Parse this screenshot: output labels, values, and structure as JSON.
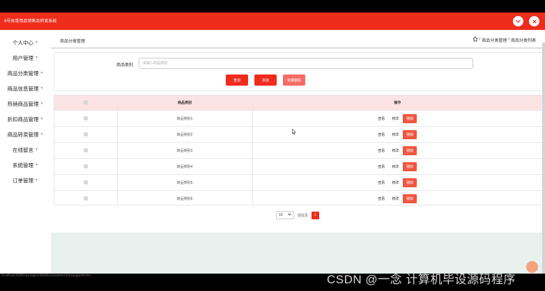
{
  "app": {
    "title": "8号体育用品销售及转卖系统"
  },
  "sidebar": {
    "items": [
      {
        "label": "个人中心"
      },
      {
        "label": "用户管理"
      },
      {
        "label": "商品分类管理"
      },
      {
        "label": "商品信息管理"
      },
      {
        "label": "热销商品管理"
      },
      {
        "label": "折扣商品管理"
      },
      {
        "label": "商品转卖管理"
      },
      {
        "label": "在线留言"
      },
      {
        "label": "系统管理"
      },
      {
        "label": "订单管理"
      }
    ]
  },
  "breadcrumb": {
    "page_title": "商品分类管理",
    "path": [
      "商品分类管理",
      "商品分类列表"
    ],
    "separator": "/"
  },
  "search": {
    "label": "商品类别",
    "placeholder": "请输入商品类别",
    "value": ""
  },
  "actions": {
    "query": "查询",
    "add": "添加",
    "batch_delete": "批量删除"
  },
  "table": {
    "headers": [
      "商品类别",
      "操作"
    ],
    "rows": [
      {
        "category": "商品类别1"
      },
      {
        "category": "商品类别2"
      },
      {
        "category": "商品类别3"
      },
      {
        "category": "商品类别4"
      },
      {
        "category": "商品类别5"
      },
      {
        "category": "商品类别6"
      }
    ],
    "ops": {
      "view": "查看",
      "edit": "修改",
      "delete": "删除"
    }
  },
  "pagination": {
    "page_size": "10",
    "goto_label": "前往页",
    "current_page": "1"
  },
  "status_url": "localhost:8080/springboot8id/front/admin/#/shangpinfenlei",
  "watermark": "CSDN @一念 计算机毕设源码程序",
  "colors": {
    "primary": "#ee2c1c",
    "header_row": "#fce3e3",
    "footer_band": "#e8f1ed"
  },
  "icons": [
    "home-icon",
    "chevron-down-icon",
    "close-icon",
    "mouse-cursor-icon"
  ]
}
